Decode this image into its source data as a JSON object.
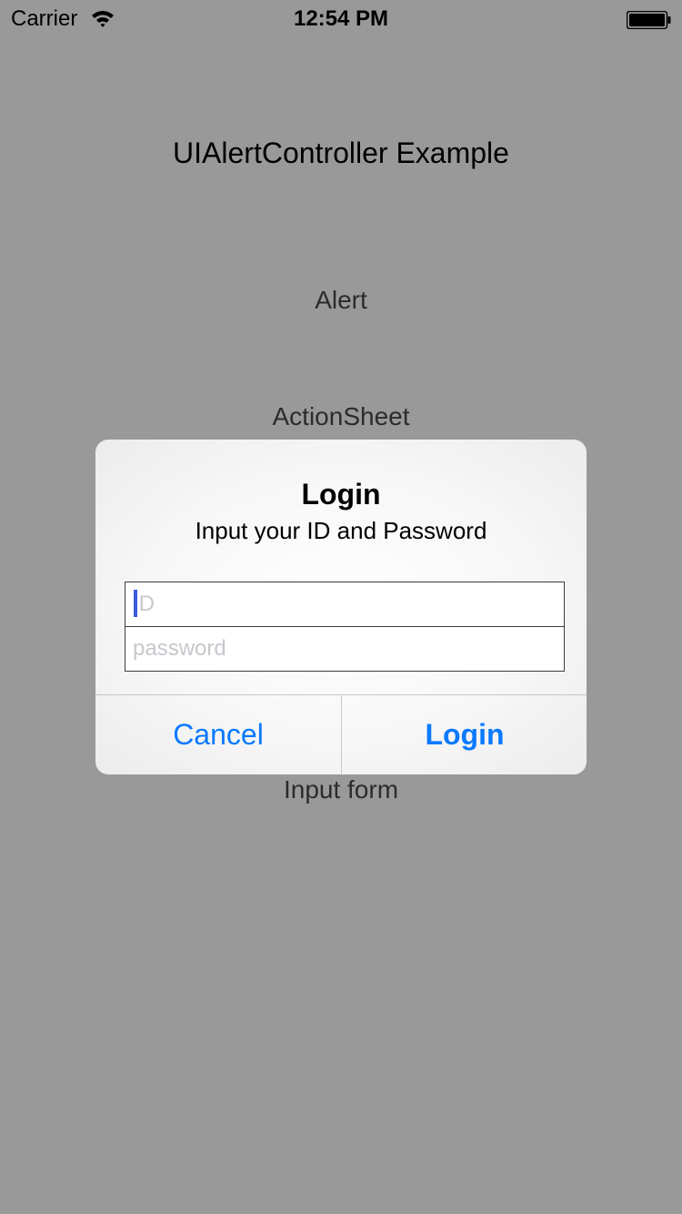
{
  "status_bar": {
    "carrier": "Carrier",
    "time": "12:54 PM",
    "wifi_icon": "wifi-icon",
    "battery_icon": "battery-icon"
  },
  "main": {
    "title": "UIAlertController Example",
    "buttons": {
      "alert": "Alert",
      "action_sheet": "ActionSheet",
      "input_form": "Input form"
    }
  },
  "alert": {
    "title": "Login",
    "message": "Input your ID and Password",
    "fields": {
      "id": {
        "value": "",
        "placeholder": "ID"
      },
      "password": {
        "value": "",
        "placeholder": "password"
      }
    },
    "actions": {
      "cancel": "Cancel",
      "login": "Login"
    }
  },
  "colors": {
    "action_blue": "#0a7aff",
    "cursor_blue": "#3b5bdb",
    "dim_overlay": "rgba(0,0,0,0.40)"
  }
}
